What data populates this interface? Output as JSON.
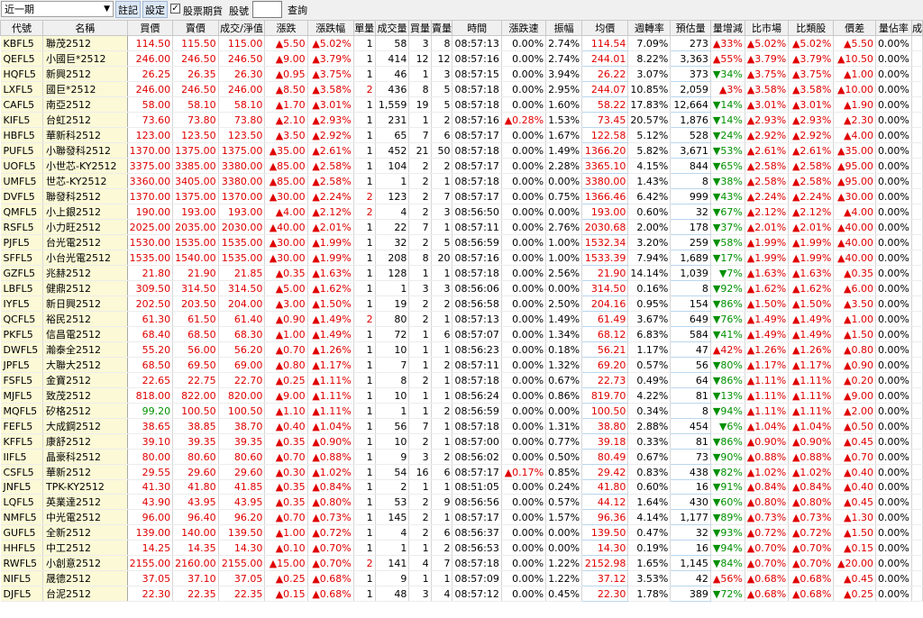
{
  "toolbar": {
    "period_value": "近一期",
    "note_button": "註記",
    "settings_button": "設定",
    "stock_futures_label": "股票期貨",
    "stock_code_label": "股號",
    "stock_code_value": "",
    "query_button": "查詢",
    "checkbox_mark": "✓"
  },
  "table": {
    "headers": [
      "代號",
      "名稱",
      "買價",
      "賣價",
      "成交/淨值",
      "漲跌",
      "漲跌幅",
      "單量",
      "成交量",
      "買量",
      "賣量",
      "時間",
      "漲跌速",
      "振幅",
      "均價",
      "週轉率",
      "預估量",
      "量增減",
      "比市場",
      "比類股",
      "價差",
      "量佔率",
      "成"
    ],
    "rows": [
      [
        "KBFL5",
        "聯茂2512",
        "114.50",
        "115.50",
        "115.00",
        "▲5.50",
        "▲5.02%",
        "1",
        "58",
        "3",
        "8",
        "08:57:13",
        "0.00%",
        "2.74%",
        "114.54",
        "7.09%",
        "273",
        "▲33%",
        "▲5.02%",
        "▲5.02%",
        "▲5.50",
        "0.00%"
      ],
      [
        "QEFL5",
        "小國巨*2512",
        "246.00",
        "246.50",
        "246.50",
        "▲9.00",
        "▲3.79%",
        "1",
        "414",
        "12",
        "12",
        "08:57:16",
        "0.00%",
        "2.74%",
        "244.01",
        "8.22%",
        "3,363",
        "▲55%",
        "▲3.79%",
        "▲3.79%",
        "▲10.50",
        "0.00%"
      ],
      [
        "HQFL5",
        "新興2512",
        "26.25",
        "26.35",
        "26.30",
        "▲0.95",
        "▲3.75%",
        "1",
        "46",
        "1",
        "3",
        "08:57:15",
        "0.00%",
        "3.94%",
        "26.22",
        "3.07%",
        "373",
        "▼34%",
        "▲3.75%",
        "▲3.75%",
        "▲1.00",
        "0.00%"
      ],
      [
        "LXFL5",
        "國巨*2512",
        "246.00",
        "246.50",
        "246.00",
        "▲8.50",
        "▲3.58%",
        "2",
        "436",
        "8",
        "5",
        "08:57:18",
        "0.00%",
        "2.95%",
        "244.07",
        "10.85%",
        "2,059",
        "▲3%",
        "▲3.58%",
        "▲3.58%",
        "▲10.00",
        "0.00%"
      ],
      [
        "CAFL5",
        "南亞2512",
        "58.00",
        "58.10",
        "58.10",
        "▲1.70",
        "▲3.01%",
        "1",
        "1,559",
        "19",
        "5",
        "08:57:18",
        "0.00%",
        "1.60%",
        "58.22",
        "17.83%",
        "12,664",
        "▼14%",
        "▲3.01%",
        "▲3.01%",
        "▲1.90",
        "0.00%"
      ],
      [
        "KIFL5",
        "台虹2512",
        "73.60",
        "73.80",
        "73.80",
        "▲2.10",
        "▲2.93%",
        "1",
        "231",
        "1",
        "2",
        "08:57:16",
        "▲0.28%",
        "1.53%",
        "73.45",
        "20.57%",
        "1,876",
        "▼14%",
        "▲2.93%",
        "▲2.93%",
        "▲2.30",
        "0.00%"
      ],
      [
        "HBFL5",
        "華新科2512",
        "123.00",
        "123.50",
        "123.50",
        "▲3.50",
        "▲2.92%",
        "1",
        "65",
        "7",
        "6",
        "08:57:17",
        "0.00%",
        "1.67%",
        "122.58",
        "5.12%",
        "528",
        "▼24%",
        "▲2.92%",
        "▲2.92%",
        "▲4.00",
        "0.00%"
      ],
      [
        "PUFL5",
        "小聯發科2512",
        "1370.00",
        "1375.00",
        "1375.00",
        "▲35.00",
        "▲2.61%",
        "1",
        "452",
        "21",
        "50",
        "08:57:18",
        "0.00%",
        "1.49%",
        "1366.20",
        "5.82%",
        "3,671",
        "▼53%",
        "▲2.61%",
        "▲2.61%",
        "▲35.00",
        "0.00%"
      ],
      [
        "UOFL5",
        "小世芯-KY2512",
        "3375.00",
        "3385.00",
        "3380.00",
        "▲85.00",
        "▲2.58%",
        "1",
        "104",
        "2",
        "2",
        "08:57:17",
        "0.00%",
        "2.28%",
        "3365.10",
        "4.15%",
        "844",
        "▼65%",
        "▲2.58%",
        "▲2.58%",
        "▲95.00",
        "0.00%"
      ],
      [
        "UMFL5",
        "世芯-KY2512",
        "3360.00",
        "3405.00",
        "3380.00",
        "▲85.00",
        "▲2.58%",
        "1",
        "1",
        "2",
        "1",
        "08:57:18",
        "0.00%",
        "0.00%",
        "3380.00",
        "1.43%",
        "8",
        "▼38%",
        "▲2.58%",
        "▲2.58%",
        "▲95.00",
        "0.00%"
      ],
      [
        "DVFL5",
        "聯發科2512",
        "1370.00",
        "1375.00",
        "1370.00",
        "▲30.00",
        "▲2.24%",
        "2",
        "123",
        "2",
        "7",
        "08:57:17",
        "0.00%",
        "0.75%",
        "1366.46",
        "6.42%",
        "999",
        "▼43%",
        "▲2.24%",
        "▲2.24%",
        "▲30.00",
        "0.00%"
      ],
      [
        "QMFL5",
        "小上銀2512",
        "190.00",
        "193.00",
        "193.00",
        "▲4.00",
        "▲2.12%",
        "2",
        "4",
        "2",
        "3",
        "08:56:50",
        "0.00%",
        "0.00%",
        "193.00",
        "0.60%",
        "32",
        "▼67%",
        "▲2.12%",
        "▲2.12%",
        "▲4.00",
        "0.00%"
      ],
      [
        "RSFL5",
        "小力旺2512",
        "2025.00",
        "2035.00",
        "2030.00",
        "▲40.00",
        "▲2.01%",
        "1",
        "22",
        "7",
        "1",
        "08:57:11",
        "0.00%",
        "2.76%",
        "2030.68",
        "2.00%",
        "178",
        "▼37%",
        "▲2.01%",
        "▲2.01%",
        "▲40.00",
        "0.00%"
      ],
      [
        "PJFL5",
        "台光電2512",
        "1530.00",
        "1535.00",
        "1535.00",
        "▲30.00",
        "▲1.99%",
        "1",
        "32",
        "2",
        "5",
        "08:56:59",
        "0.00%",
        "1.00%",
        "1532.34",
        "3.20%",
        "259",
        "▼58%",
        "▲1.99%",
        "▲1.99%",
        "▲40.00",
        "0.00%"
      ],
      [
        "SFFL5",
        "小台光電2512",
        "1535.00",
        "1540.00",
        "1535.00",
        "▲30.00",
        "▲1.99%",
        "1",
        "208",
        "8",
        "20",
        "08:57:16",
        "0.00%",
        "1.00%",
        "1533.39",
        "7.94%",
        "1,689",
        "▼17%",
        "▲1.99%",
        "▲1.99%",
        "▲40.00",
        "0.00%"
      ],
      [
        "GZFL5",
        "兆赫2512",
        "21.80",
        "21.90",
        "21.85",
        "▲0.35",
        "▲1.63%",
        "1",
        "128",
        "1",
        "1",
        "08:57:18",
        "0.00%",
        "2.56%",
        "21.90",
        "14.14%",
        "1,039",
        "▼7%",
        "▲1.63%",
        "▲1.63%",
        "▲0.35",
        "0.00%"
      ],
      [
        "LBFL5",
        "健鼎2512",
        "309.50",
        "314.50",
        "314.50",
        "▲5.00",
        "▲1.62%",
        "1",
        "1",
        "3",
        "3",
        "08:56:06",
        "0.00%",
        "0.00%",
        "314.50",
        "0.16%",
        "8",
        "▼92%",
        "▲1.62%",
        "▲1.62%",
        "▲6.00",
        "0.00%"
      ],
      [
        "IYFL5",
        "新日興2512",
        "202.50",
        "203.50",
        "204.00",
        "▲3.00",
        "▲1.50%",
        "1",
        "19",
        "2",
        "2",
        "08:56:58",
        "0.00%",
        "2.50%",
        "204.16",
        "0.95%",
        "154",
        "▼86%",
        "▲1.50%",
        "▲1.50%",
        "▲3.50",
        "0.00%"
      ],
      [
        "QCFL5",
        "裕民2512",
        "61.30",
        "61.50",
        "61.40",
        "▲0.90",
        "▲1.49%",
        "2",
        "80",
        "2",
        "1",
        "08:57:13",
        "0.00%",
        "1.49%",
        "61.49",
        "3.67%",
        "649",
        "▼76%",
        "▲1.49%",
        "▲1.49%",
        "▲1.00",
        "0.00%"
      ],
      [
        "PKFL5",
        "信昌電2512",
        "68.40",
        "68.50",
        "68.30",
        "▲1.00",
        "▲1.49%",
        "1",
        "72",
        "1",
        "6",
        "08:57:07",
        "0.00%",
        "1.34%",
        "68.12",
        "6.83%",
        "584",
        "▼41%",
        "▲1.49%",
        "▲1.49%",
        "▲1.50",
        "0.00%"
      ],
      [
        "DWFL5",
        "瀚泰全2512",
        "55.20",
        "56.00",
        "56.20",
        "▲0.70",
        "▲1.26%",
        "1",
        "10",
        "1",
        "1",
        "08:56:23",
        "0.00%",
        "0.18%",
        "56.21",
        "1.17%",
        "47",
        "▲42%",
        "▲1.26%",
        "▲1.26%",
        "▲0.80",
        "0.00%"
      ],
      [
        "JPFL5",
        "大聯大2512",
        "68.50",
        "69.50",
        "69.00",
        "▲0.80",
        "▲1.17%",
        "1",
        "7",
        "1",
        "2",
        "08:57:11",
        "0.00%",
        "1.32%",
        "69.20",
        "0.57%",
        "56",
        "▼80%",
        "▲1.17%",
        "▲1.17%",
        "▲0.90",
        "0.00%"
      ],
      [
        "FSFL5",
        "金寶2512",
        "22.65",
        "22.75",
        "22.70",
        "▲0.25",
        "▲1.11%",
        "1",
        "8",
        "2",
        "1",
        "08:57:18",
        "0.00%",
        "0.67%",
        "22.73",
        "0.49%",
        "64",
        "▼86%",
        "▲1.11%",
        "▲1.11%",
        "▲0.20",
        "0.00%"
      ],
      [
        "MJFL5",
        "致茂2512",
        "818.00",
        "822.00",
        "820.00",
        "▲9.00",
        "▲1.11%",
        "1",
        "10",
        "1",
        "1",
        "08:56:24",
        "0.00%",
        "0.86%",
        "819.70",
        "4.22%",
        "81",
        "▼13%",
        "▲1.11%",
        "▲1.11%",
        "▲9.00",
        "0.00%"
      ],
      [
        "MQFL5",
        "矽格2512",
        "99.20",
        "100.50",
        "100.50",
        "▲1.10",
        "▲1.11%",
        "1",
        "1",
        "1",
        "2",
        "08:56:59",
        "0.00%",
        "0.00%",
        "100.50",
        "0.34%",
        "8",
        "▼94%",
        "▲1.11%",
        "▲1.11%",
        "▲2.00",
        "0.00%"
      ],
      [
        "FEFL5",
        "大成鋼2512",
        "38.65",
        "38.85",
        "38.70",
        "▲0.40",
        "▲1.04%",
        "1",
        "56",
        "7",
        "1",
        "08:57:18",
        "0.00%",
        "1.31%",
        "38.80",
        "2.88%",
        "454",
        "▼6%",
        "▲1.04%",
        "▲1.04%",
        "▲0.50",
        "0.00%"
      ],
      [
        "KFFL5",
        "康舒2512",
        "39.10",
        "39.35",
        "39.35",
        "▲0.35",
        "▲0.90%",
        "1",
        "10",
        "2",
        "1",
        "08:57:00",
        "0.00%",
        "0.77%",
        "39.18",
        "0.33%",
        "81",
        "▼86%",
        "▲0.90%",
        "▲0.90%",
        "▲0.45",
        "0.00%"
      ],
      [
        "IIFL5",
        "晶豪科2512",
        "80.00",
        "80.60",
        "80.60",
        "▲0.70",
        "▲0.88%",
        "1",
        "9",
        "3",
        "2",
        "08:56:02",
        "0.00%",
        "0.50%",
        "80.49",
        "0.67%",
        "73",
        "▼90%",
        "▲0.88%",
        "▲0.88%",
        "▲0.70",
        "0.00%"
      ],
      [
        "CSFL5",
        "華新2512",
        "29.55",
        "29.60",
        "29.60",
        "▲0.30",
        "▲1.02%",
        "1",
        "54",
        "16",
        "6",
        "08:57:17",
        "▲0.17%",
        "0.85%",
        "29.42",
        "0.83%",
        "438",
        "▼82%",
        "▲1.02%",
        "▲1.02%",
        "▲0.40",
        "0.00%"
      ],
      [
        "JNFL5",
        "TPK-KY2512",
        "41.30",
        "41.80",
        "41.85",
        "▲0.35",
        "▲0.84%",
        "1",
        "2",
        "1",
        "1",
        "08:51:05",
        "0.00%",
        "0.24%",
        "41.80",
        "0.60%",
        "16",
        "▼91%",
        "▲0.84%",
        "▲0.84%",
        "▲0.40",
        "0.00%"
      ],
      [
        "LQFL5",
        "英業達2512",
        "43.90",
        "43.95",
        "43.95",
        "▲0.35",
        "▲0.80%",
        "1",
        "53",
        "2",
        "9",
        "08:56:56",
        "0.00%",
        "0.57%",
        "44.12",
        "1.64%",
        "430",
        "▼60%",
        "▲0.80%",
        "▲0.80%",
        "▲0.45",
        "0.00%"
      ],
      [
        "NMFL5",
        "中光電2512",
        "96.00",
        "96.40",
        "96.20",
        "▲0.70",
        "▲0.73%",
        "1",
        "145",
        "2",
        "1",
        "08:57:17",
        "0.00%",
        "1.57%",
        "96.36",
        "4.14%",
        "1,177",
        "▼89%",
        "▲0.73%",
        "▲0.73%",
        "▲1.30",
        "0.00%"
      ],
      [
        "GUFL5",
        "全新2512",
        "139.00",
        "140.00",
        "139.50",
        "▲1.00",
        "▲0.72%",
        "1",
        "4",
        "2",
        "6",
        "08:56:37",
        "0.00%",
        "0.00%",
        "139.50",
        "0.47%",
        "32",
        "▼93%",
        "▲0.72%",
        "▲0.72%",
        "▲1.50",
        "0.00%"
      ],
      [
        "HHFL5",
        "中工2512",
        "14.25",
        "14.35",
        "14.30",
        "▲0.10",
        "▲0.70%",
        "1",
        "1",
        "1",
        "2",
        "08:56:53",
        "0.00%",
        "0.00%",
        "14.30",
        "0.19%",
        "16",
        "▼94%",
        "▲0.70%",
        "▲0.70%",
        "▲0.15",
        "0.00%"
      ],
      [
        "RWFL5",
        "小創意2512",
        "2155.00",
        "2160.00",
        "2155.00",
        "▲15.00",
        "▲0.70%",
        "2",
        "141",
        "4",
        "7",
        "08:57:18",
        "0.00%",
        "1.22%",
        "2152.98",
        "1.65%",
        "1,145",
        "▼84%",
        "▲0.70%",
        "▲0.70%",
        "▲20.00",
        "0.00%"
      ],
      [
        "NIFL5",
        "晟德2512",
        "37.05",
        "37.10",
        "37.05",
        "▲0.25",
        "▲0.68%",
        "1",
        "9",
        "1",
        "1",
        "08:57:09",
        "0.00%",
        "1.22%",
        "37.12",
        "3.53%",
        "42",
        "▲56%",
        "▲0.68%",
        "▲0.68%",
        "▲0.45",
        "0.00%"
      ],
      [
        "DJFL5",
        "台泥2512",
        "22.30",
        "22.35",
        "22.35",
        "▲0.15",
        "▲0.68%",
        "1",
        "48",
        "3",
        "4",
        "08:57:12",
        "0.00%",
        "0.45%",
        "22.30",
        "1.78%",
        "389",
        "▼72%",
        "▲0.68%",
        "▲0.68%",
        "▲0.25",
        "0.00%"
      ]
    ]
  }
}
